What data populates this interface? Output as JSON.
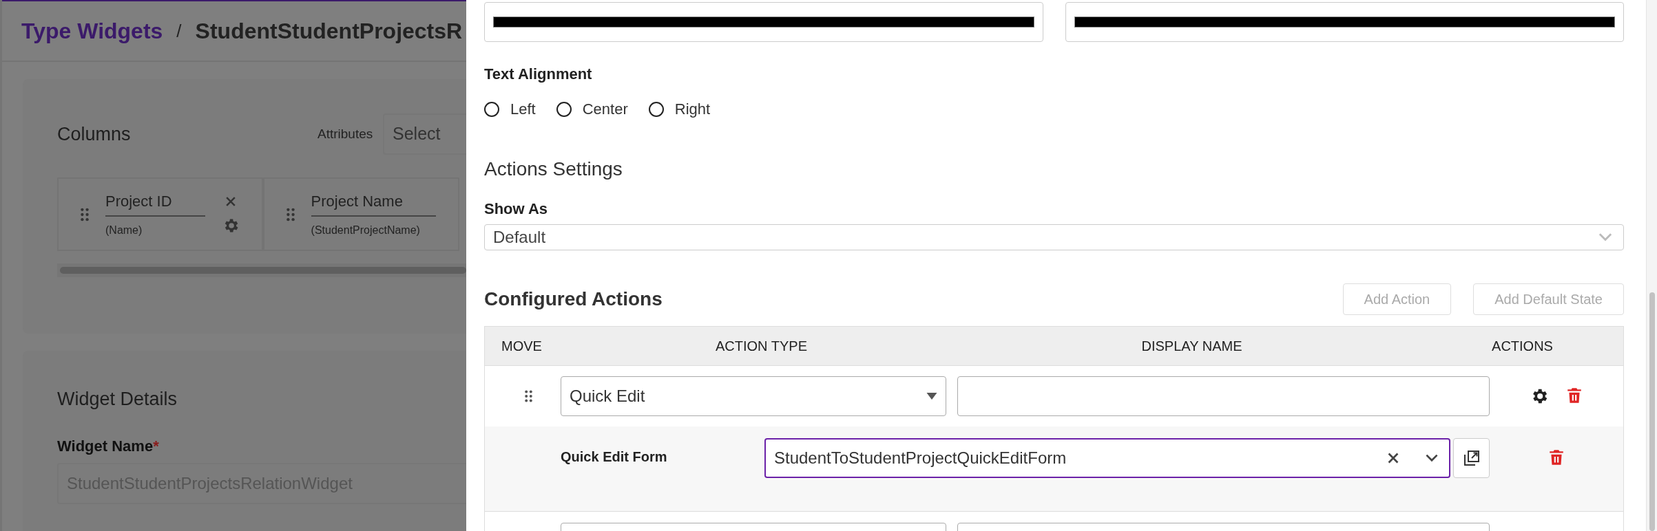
{
  "background_page": {
    "breadcrumb": {
      "parent": "Type Widgets",
      "separator": "/",
      "current": "StudentStudentProjectsR"
    },
    "columns_card": {
      "title": "Columns",
      "attributes_label": "Attributes",
      "attributes_placeholder": "Select",
      "columns": [
        {
          "label": "Project ID",
          "attribute": "(Name)",
          "controls_visible": true
        },
        {
          "label": "Project Name",
          "attribute": "(StudentProjectName)",
          "controls_visible": false
        }
      ]
    },
    "widget_details": {
      "title": "Widget Details",
      "widget_name": {
        "label": "Widget Name",
        "required": true,
        "required_mark": "*",
        "disabled": true,
        "value": "StudentStudentProjectsRelationWidget"
      }
    }
  },
  "panel": {
    "top_fields": [
      {
        "redacted": true
      },
      {
        "redacted": true
      }
    ],
    "text_alignment": {
      "label": "Text Alignment",
      "options": [
        {
          "label": "Left",
          "selected": false
        },
        {
          "label": "Center",
          "selected": false
        },
        {
          "label": "Right",
          "selected": false
        }
      ]
    },
    "actions_settings": {
      "title": "Actions Settings",
      "show_as": {
        "label": "Show As",
        "value": "Default"
      }
    },
    "configured_actions": {
      "title": "Configured Actions",
      "buttons": [
        {
          "label": "Add Action",
          "disabled": true
        },
        {
          "label": "Add Default State",
          "disabled": true
        }
      ],
      "columns": [
        "MOVE",
        "ACTION TYPE",
        "DISPLAY NAME",
        "ACTIONS"
      ],
      "rows": [
        {
          "action_type": "Quick Edit",
          "sub": {
            "label": "Quick Edit Form",
            "value": "StudentToStudentProjectQuickEditForm"
          }
        }
      ]
    }
  }
}
